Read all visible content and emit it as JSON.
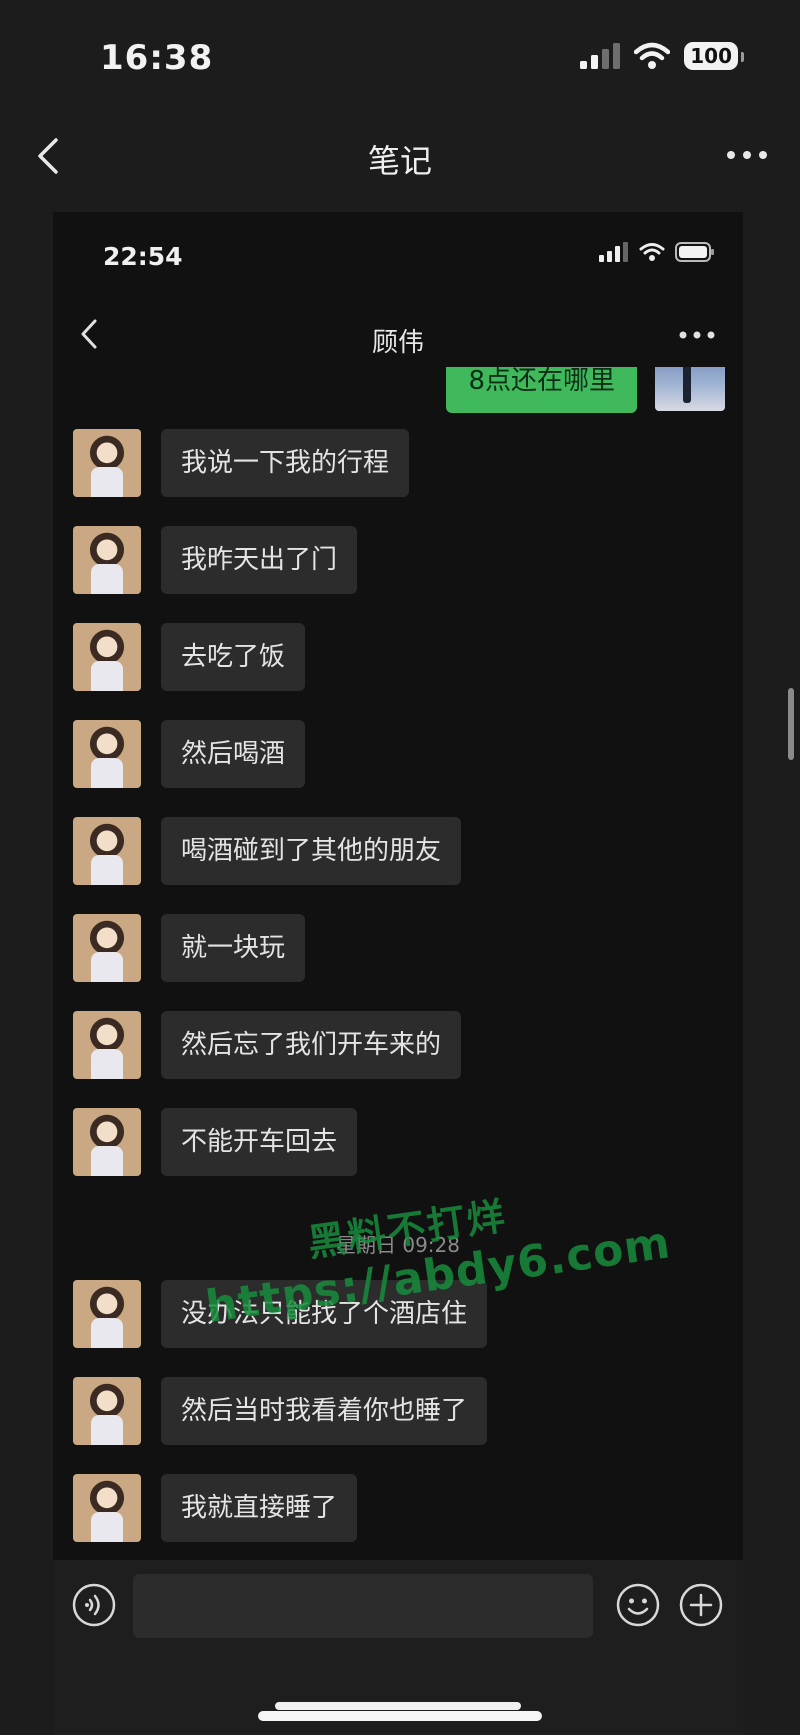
{
  "outer": {
    "time": "16:38",
    "battery": "100",
    "title": "笔记"
  },
  "inner": {
    "time": "22:54",
    "title": "顾伟",
    "outgoing_message": "8点还在哪里",
    "messages_before": [
      "我说一下我的行程",
      "我昨天出了门",
      "去吃了饭",
      "然后喝酒",
      "喝酒碰到了其他的朋友",
      "就一块玩",
      "然后忘了我们开车来的",
      "不能开车回去"
    ],
    "timestamp": "星期日 09:28",
    "messages_after": [
      "没办法只能找了个酒店住",
      "然后当时我看着你也睡了",
      "我就直接睡了"
    ],
    "input_placeholder": ""
  },
  "watermark": {
    "line1": "黑料不打烊",
    "line2": "https://abdy6.com"
  },
  "colors": {
    "background": "#1c1c1c",
    "chat_background": "#111111",
    "bubble_in": "#2c2c2c",
    "bubble_out": "#3fb95c",
    "watermark": "#188c3c"
  },
  "icons": {
    "outer_back": "chevron-left-icon",
    "outer_more": "more-horizontal-icon",
    "signal": "signal-icon",
    "wifi": "wifi-icon",
    "battery": "battery-icon",
    "voice": "voice-icon",
    "emoji": "emoji-icon",
    "plus": "plus-circle-icon"
  }
}
